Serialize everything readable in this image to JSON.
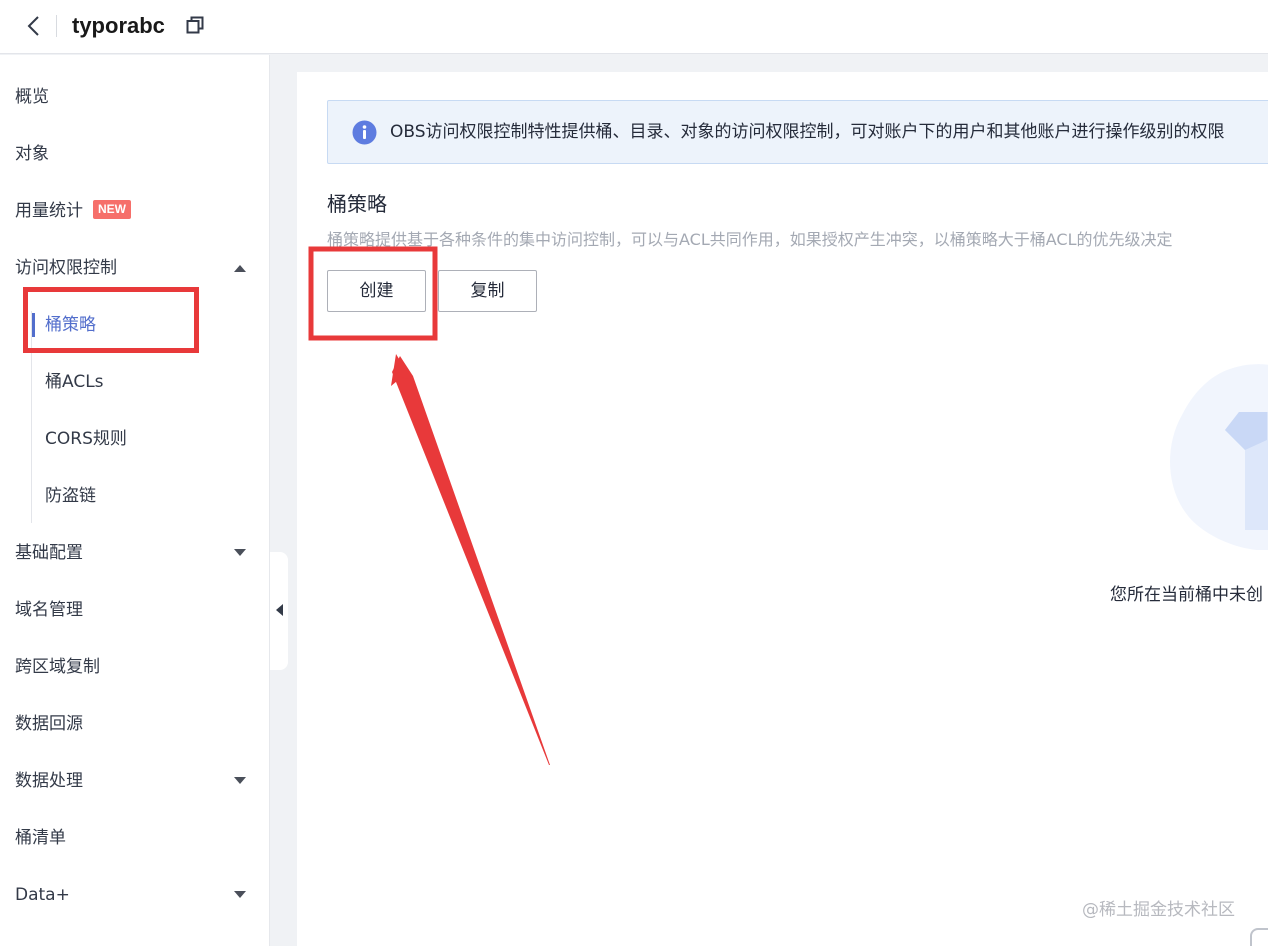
{
  "header": {
    "bucket_name": "typorabc"
  },
  "sidebar": {
    "items": [
      {
        "label": "概览"
      },
      {
        "label": "对象"
      },
      {
        "label": "用量统计",
        "badge": "NEW"
      },
      {
        "label": "访问权限控制",
        "expanded": true
      },
      {
        "label": "基础配置",
        "expanded": false
      },
      {
        "label": "域名管理"
      },
      {
        "label": "跨区域复制"
      },
      {
        "label": "数据回源"
      },
      {
        "label": "数据处理",
        "expanded": false
      },
      {
        "label": "桶清单"
      },
      {
        "label": "Data+",
        "expanded": false
      }
    ],
    "access_control_children": [
      {
        "label": "桶策略",
        "active": true
      },
      {
        "label": "桶ACLs"
      },
      {
        "label": "CORS规则"
      },
      {
        "label": "防盗链"
      }
    ]
  },
  "main": {
    "info_banner": "OBS访问权限控制特性提供桶、目录、对象的访问权限控制，可对账户下的用户和其他账户进行操作级别的权限",
    "section_title": "桶策略",
    "section_desc": "桶策略提供基于各种条件的集中访问控制，可以与ACL共同作用，如果授权产生冲突，以桶策略大于桶ACL的优先级决定",
    "create_button": "创建",
    "copy_button": "复制",
    "empty_text": "您所在当前桶中未创"
  },
  "watermark": "@稀土掘金技术社区",
  "colors": {
    "accent": "#526ecc",
    "badge": "#f66f6a",
    "annotation": "#e8393a",
    "banner_bg": "#edf3fb"
  },
  "icons": {
    "back": "chevron-left-icon",
    "copy": "copy-icon",
    "info": "info-icon",
    "expand": "caret-up-icon",
    "collapse": "caret-down-icon",
    "sidebar_toggle": "collapse-left-icon"
  }
}
